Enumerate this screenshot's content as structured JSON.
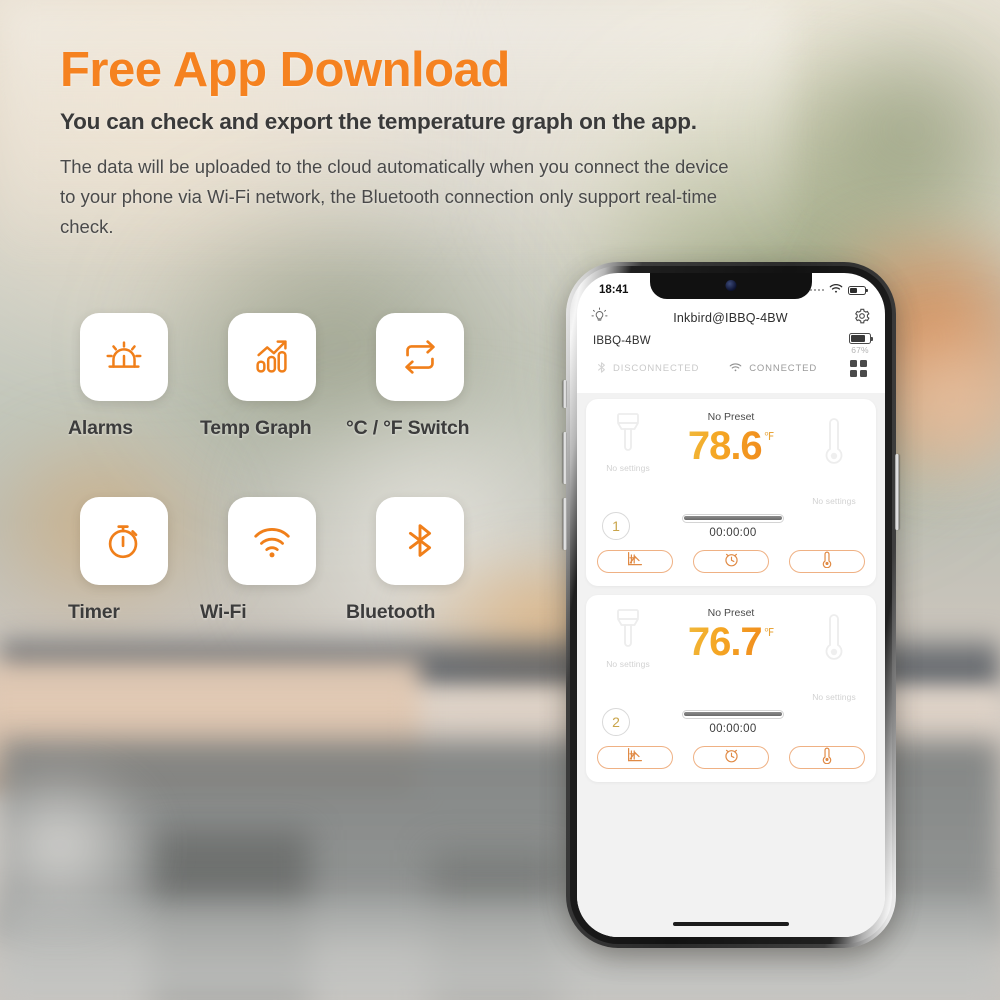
{
  "headline": {
    "title": "Free App Download",
    "subtitle": "You can check and export the temperature graph on the app.",
    "paragraph": "The data will be uploaded to the cloud automatically when you connect the device to your phone via Wi-Fi network, the Bluetooth connection only support real-time check.",
    "title_color": "#F58220",
    "text_color": "#3a3a3a"
  },
  "features": [
    {
      "label": "Alarms",
      "icon": "alarm-siren-icon"
    },
    {
      "label": "Temp Graph",
      "icon": "bar-chart-trend-icon"
    },
    {
      "label": "°C / °F Switch",
      "icon": "loop-switch-icon"
    },
    {
      "label": "Timer",
      "icon": "stopwatch-icon"
    },
    {
      "label": "Wi-Fi",
      "icon": "wifi-icon"
    },
    {
      "label": "Bluetooth",
      "icon": "bluetooth-icon"
    }
  ],
  "feature_icon_color": "#F07F1A",
  "phone": {
    "status_bar": {
      "time": "18:41",
      "signal_icon": "signal-dots-icon",
      "wifi_icon": "wifi-icon",
      "battery_icon": "battery-icon"
    },
    "app_header": {
      "brightness_icon": "brightness-icon",
      "title": "Inkbird@IBBQ-4BW",
      "settings_icon": "gear-icon",
      "device_name": "IBBQ-4BW",
      "battery_icon": "battery-icon",
      "battery_percent": "67%",
      "bluetooth_status_icon": "bluetooth-icon",
      "bluetooth_status": "DISCONNECTED",
      "wifi_status_icon": "wifi-icon",
      "wifi_status": "CONNECTED",
      "grid_icon": "grid-menu-icon"
    },
    "cards": [
      {
        "food_icon": "brush-icon",
        "food_setting": "No settings",
        "preset": "No Preset",
        "temperature": "78.6",
        "unit": "℉",
        "thermometer_icon": "thermometer-icon",
        "temp_setting": "No settings",
        "probe_number": "1",
        "progress": 100,
        "timer": "00:00:00",
        "actions": [
          {
            "icon": "chart-icon"
          },
          {
            "icon": "alarm-clock-icon"
          },
          {
            "icon": "thermometer-icon"
          }
        ]
      },
      {
        "food_icon": "brush-icon",
        "food_setting": "No settings",
        "preset": "No Preset",
        "temperature": "76.7",
        "unit": "℉",
        "thermometer_icon": "thermometer-icon",
        "temp_setting": "No settings",
        "probe_number": "2",
        "progress": 100,
        "timer": "00:00:00",
        "actions": [
          {
            "icon": "chart-icon"
          },
          {
            "icon": "alarm-clock-icon"
          },
          {
            "icon": "thermometer-icon"
          }
        ]
      }
    ],
    "home_indicator": "home-indicator"
  },
  "colors": {
    "accent_orange": "#F58220",
    "temp_gold": "#F5A623",
    "button_border": "#efb184",
    "muted_grey": "#c9c9c9"
  }
}
